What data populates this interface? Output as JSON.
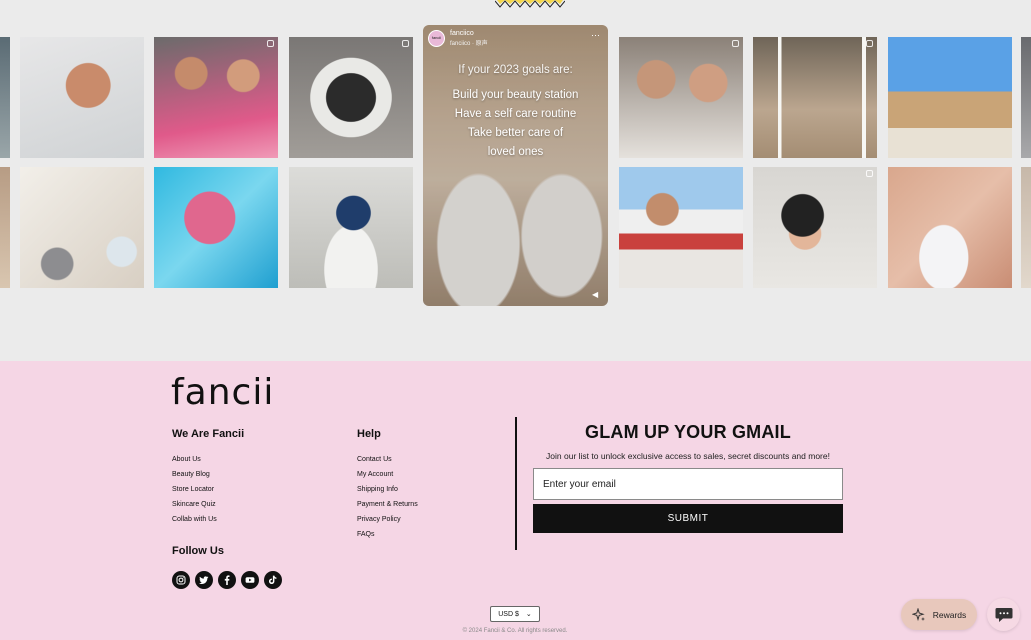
{
  "featured_post": {
    "username": "fanciico",
    "subtitle": "fanciico · 原声",
    "avatar_text": "fancii",
    "overlay_lines": [
      "If your 2023 goals are:",
      "Build your beauty station",
      "Have a self care routine",
      "Take better care of",
      "loved ones"
    ]
  },
  "footer": {
    "logo": "fancii",
    "col1": {
      "title": "We Are Fancii",
      "links": [
        "About Us",
        "Beauty Blog",
        "Store Locator",
        "Skincare Quiz",
        "Collab with Us"
      ]
    },
    "col2": {
      "title": "Help",
      "links": [
        "Contact Us",
        "My Account",
        "Shipping Info",
        "Payment & Returns",
        "Privacy Policy",
        "FAQs"
      ]
    },
    "follow": {
      "title": "Follow Us",
      "icons": [
        "instagram-icon",
        "twitter-icon",
        "facebook-icon",
        "youtube-icon",
        "tiktok-icon"
      ]
    },
    "newsletter": {
      "title": "GLAM UP YOUR GMAIL",
      "description": "Join our list to unlock exclusive access to sales, secret discounts and more!",
      "placeholder": "Enter your email",
      "submit_label": "SUBMIT"
    },
    "currency": "USD $",
    "copyright": "© 2024 Fancii & Co.  All rights reserved."
  },
  "widgets": {
    "rewards_label": "Rewards"
  },
  "colors": {
    "footer_bg": "#f5d6e5",
    "gallery_bg": "#ebebeb",
    "button_bg": "#111111",
    "rewards_bg": "#e8c8bc"
  }
}
